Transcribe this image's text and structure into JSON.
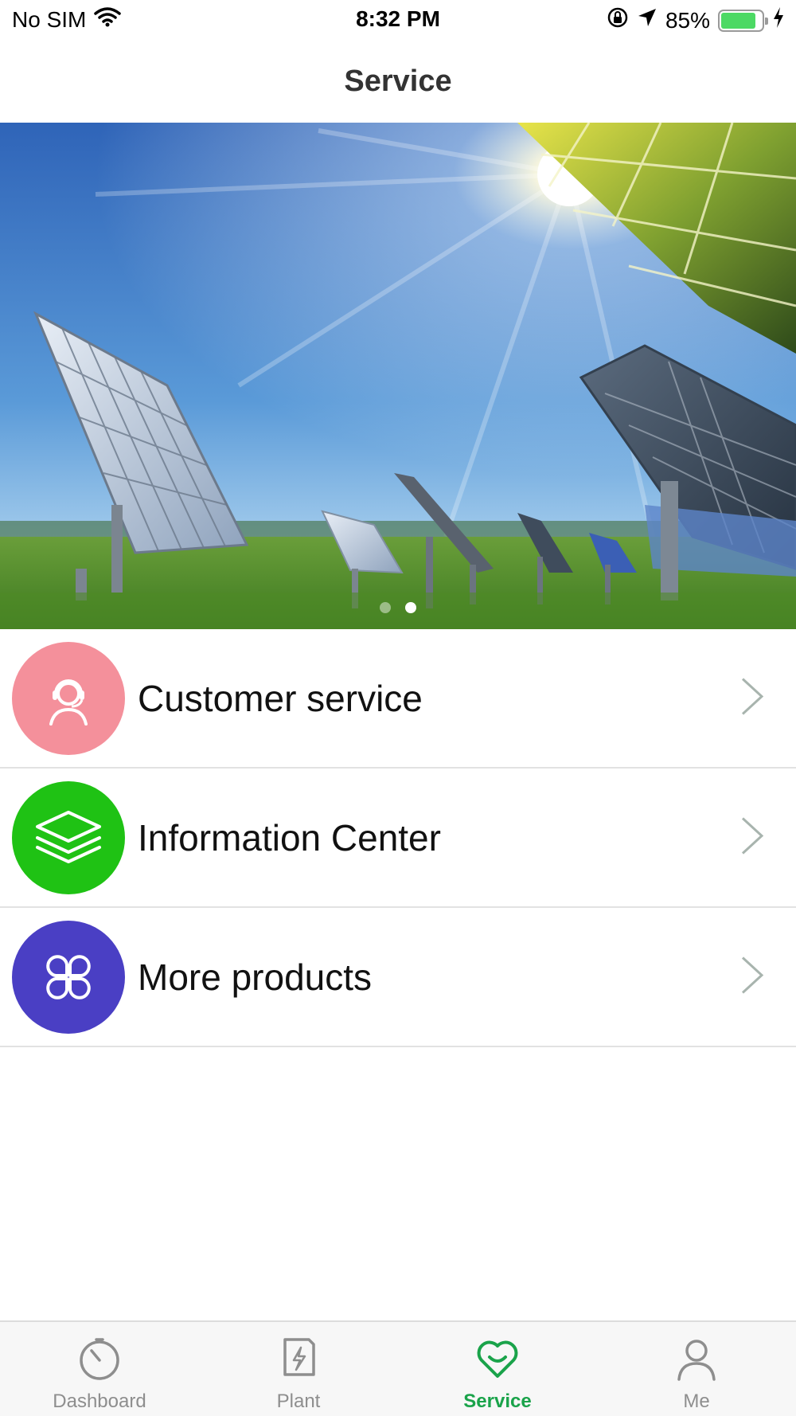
{
  "status_bar": {
    "carrier": "No SIM",
    "time": "8:32 PM",
    "battery": "85%",
    "battery_level": 0.85,
    "battery_color": "#4cd964"
  },
  "header": {
    "title": "Service"
  },
  "banner": {
    "slide_count": 2,
    "active_slide": 2
  },
  "menu": {
    "items": [
      {
        "label": "Customer service",
        "icon": "headset-agent-icon",
        "color": "#f4909b"
      },
      {
        "label": "Information Center",
        "icon": "layers-icon",
        "color": "#1fc214"
      },
      {
        "label": "More products",
        "icon": "four-petal-grid-icon",
        "color": "#4a3fc4"
      }
    ]
  },
  "tab_bar": {
    "active_color": "#1aa34a",
    "inactive_color": "#8e8e8e",
    "tabs": [
      {
        "label": "Dashboard",
        "icon": "gauge-icon"
      },
      {
        "label": "Plant",
        "icon": "plant-bolt-icon"
      },
      {
        "label": "Service",
        "icon": "heart-smile-icon",
        "active": true
      },
      {
        "label": "Me",
        "icon": "person-icon"
      }
    ]
  }
}
